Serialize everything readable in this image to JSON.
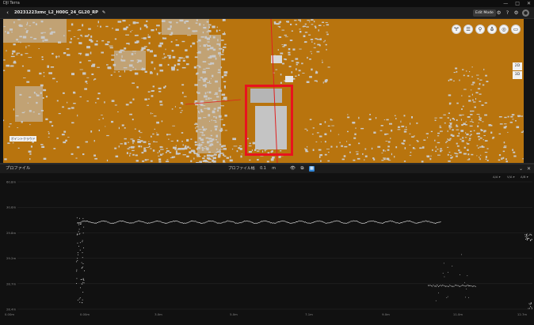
{
  "window": {
    "app_name": "DJI Terra",
    "minimize": "—",
    "maximize": "□",
    "close": "✕"
  },
  "toolbar": {
    "back_icon": "‹",
    "project_title": "20231223zmc_L2_H00G_24_GL20_RP",
    "edit_icon": "✎",
    "edit_mode_label": "Edit Mode",
    "icons": [
      "gear-icon",
      "help-icon",
      "settings-icon",
      "user-icon"
    ]
  },
  "viewport": {
    "tools": [
      "🝖",
      "☰",
      "⚲",
      "⛢",
      "◎",
      "▭"
    ],
    "view_2d": "2D",
    "view_3d": "3D",
    "scale_label": "ポイントクラウド"
  },
  "profile": {
    "title": "プロファイル",
    "width_label": "プロファイル幅",
    "width_value": "0.1",
    "width_unit": "m",
    "axis_controls": [
      "A/A ▾",
      "V/A ▾",
      "A/B ▾"
    ],
    "y_ticks": [
      "60.8m",
      "30.6m",
      "29.8m",
      "29.2m",
      "28.7m",
      "28.4m"
    ],
    "x_ticks": [
      "0.00m",
      "0.00m",
      "3.0m",
      "5.0m",
      "7.1m",
      "9.0m",
      "11.0m",
      "12.7m"
    ]
  },
  "colors": {
    "ground": "#b8740e",
    "points": "#c9c9c9",
    "selection": "#e8131e",
    "accent": "#2f84d6"
  }
}
